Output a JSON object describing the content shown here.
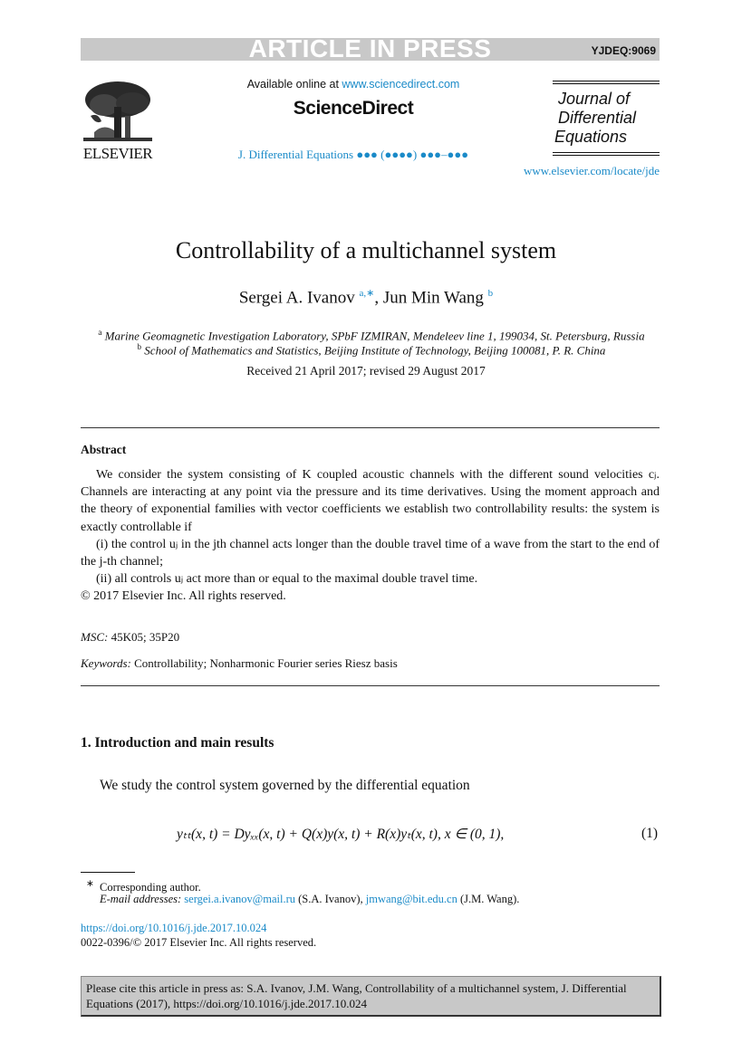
{
  "banner": {
    "title": "ARTICLE IN PRESS",
    "code": "YJDEQ:9069"
  },
  "header": {
    "publisher": "ELSEVIER",
    "available_prefix": "Available online at ",
    "available_link": "www.sciencedirect.com",
    "platform": "ScienceDirect",
    "journal_ref": "J. Differential Equations ●●● (●●●●) ●●●–●●●",
    "journal_lines": [
      "Journal of",
      "Differential",
      "Equations"
    ],
    "locate_link": "www.elsevier.com/locate/jde"
  },
  "article": {
    "title": "Controllability of a multichannel system",
    "authors": [
      {
        "name": "Sergei A. Ivanov",
        "marks": "a,∗"
      },
      {
        "name": "Jun Min Wang",
        "marks": "b"
      }
    ],
    "affiliations": [
      {
        "mark": "a",
        "text": "Marine Geomagnetic Investigation Laboratory, SPbF IZMIRAN, Mendeleev line 1, 199034, St. Petersburg, Russia"
      },
      {
        "mark": "b",
        "text": "School of Mathematics and Statistics, Beijing Institute of Technology, Beijing 100081, P. R. China"
      }
    ],
    "received": "Received 21 April 2017; revised 29 August 2017"
  },
  "abstract": {
    "heading": "Abstract",
    "p1": "We consider the system consisting of K coupled acoustic channels with the different sound velocities cⱼ. Channels are interacting at any point via the pressure and its time derivatives. Using the moment approach and the theory of exponential families with vector coefficients we establish two controllability results: the system is exactly controllable if",
    "p2": "(i) the control uⱼ in the jth channel acts longer than the double travel time of a wave from the start to the end of the j-th channel;",
    "p3": "(ii) all controls uⱼ act more than or equal to the maximal double travel time.",
    "copyright": "© 2017 Elsevier Inc. All rights reserved."
  },
  "msc": {
    "label": "MSC:",
    "value": " 45K05; 35P20"
  },
  "keywords": {
    "label": "Keywords:",
    "value": " Controllability; Nonharmonic Fourier series Riesz basis"
  },
  "section1": {
    "heading": "1.  Introduction and main results",
    "intro": "We study the control system governed by the differential equation",
    "equation": "yₜₜ(x, t) = Dyₓₓ(x, t) + Q(x)y(x, t) + R(x)yₜ(x, t),  x ∈ (0, 1),",
    "equation_number": "(1)"
  },
  "footnotes": {
    "star": "∗",
    "corresponding": "Corresponding author.",
    "email_label": "E-mail addresses:",
    "email1": "sergei.a.ivanov@mail.ru",
    "email1_owner": " (S.A. Ivanov), ",
    "email2": "jmwang@bit.edu.cn",
    "email2_owner": " (J.M. Wang)."
  },
  "doi": "https://doi.org/10.1016/j.jde.2017.10.024",
  "issn_line": "0022-0396/© 2017 Elsevier Inc. All rights reserved.",
  "citation_box": "Please cite this article in press as: S.A. Ivanov, J.M. Wang, Controllability of a multichannel system, J. Differential Equations (2017), https://doi.org/10.1016/j.jde.2017.10.024"
}
